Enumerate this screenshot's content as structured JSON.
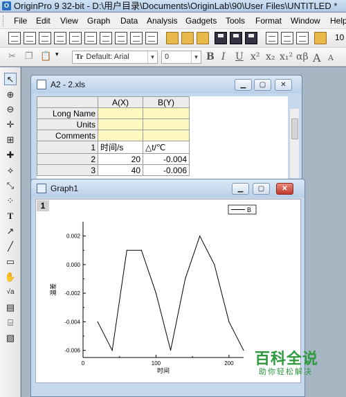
{
  "app": {
    "title": "OriginPro 9 32-bit - D:\\用户目录\\Documents\\OriginLab\\90\\User Files\\UNTITLED *"
  },
  "menu": [
    "File",
    "Edit",
    "View",
    "Graph",
    "Data",
    "Analysis",
    "Gadgets",
    "Tools",
    "Format",
    "Window",
    "Help"
  ],
  "format_toolbar": {
    "font": "Default: Arial",
    "size": "0",
    "bold": "B",
    "italic": "I",
    "underline": "U",
    "superscript": "x²",
    "subscript": "x₂",
    "supsub": "x₁²",
    "greek": "αβ",
    "grow": "A",
    "shrink": "A"
  },
  "toolbar_overflow": "10",
  "worksheet": {
    "title": "A2 - 2.xls",
    "columns": [
      "A(X)",
      "B(Y)"
    ],
    "row_labels": [
      "Long Name",
      "Units",
      "Comments"
    ],
    "rows": [
      {
        "n": "1",
        "a": "时间/s",
        "b": "△t/℃"
      },
      {
        "n": "2",
        "a": "20",
        "b": "-0.004"
      },
      {
        "n": "3",
        "a": "40",
        "b": "-0.006"
      }
    ]
  },
  "graph": {
    "title": "Graph1",
    "layer": "1"
  },
  "chart_data": {
    "type": "line",
    "series": [
      {
        "name": "B",
        "x": [
          20,
          40,
          60,
          80,
          100,
          120,
          140,
          160,
          180,
          200,
          220
        ],
        "y": [
          -0.004,
          -0.006,
          0.001,
          0.001,
          -0.002,
          -0.006,
          -0.001,
          0.002,
          0.0,
          -0.004,
          -0.006
        ]
      }
    ],
    "xlabel": "时间",
    "ylabel": "温差",
    "xlim": [
      0,
      220
    ],
    "ylim": [
      -0.0065,
      0.003
    ],
    "xticks": [
      "0",
      "100",
      "200"
    ],
    "yticks": [
      "0.002",
      "0.000",
      "-0.002",
      "-0.004",
      "-0.006"
    ],
    "legend": "top-right",
    "grid": false
  },
  "watermark": {
    "main": "百科全说",
    "sub": "助你轻松解决"
  }
}
